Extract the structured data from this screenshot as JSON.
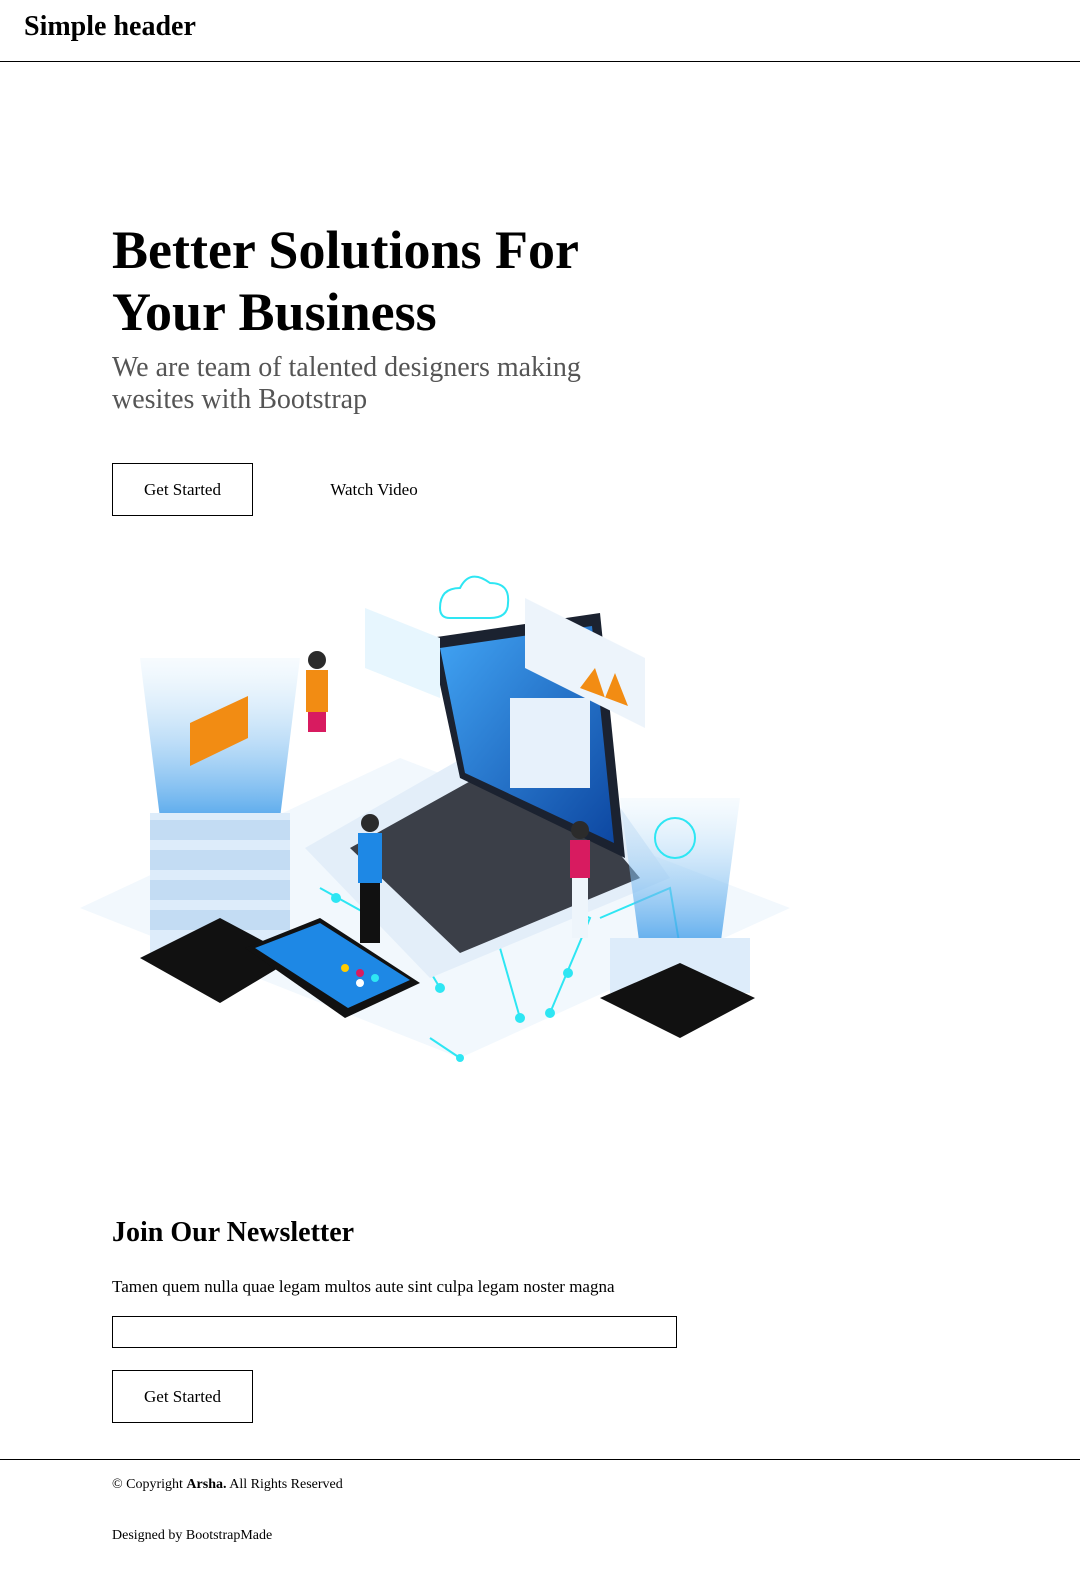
{
  "header": {
    "title": "Simple header"
  },
  "hero": {
    "title": "Better Solutions For Your Business",
    "subtitle": "We are team of talented designers making wesites with Bootstrap",
    "primary_button": "Get Started",
    "secondary_button": "Watch Video",
    "colors": {
      "accent_blue": "#1e88e5",
      "cyan": "#20d8f0",
      "orange": "#f28c13",
      "pink": "#d81b60"
    }
  },
  "newsletter": {
    "title": "Join Our Newsletter",
    "text": "Tamen quem nulla quae legam multos aute sint culpa legam noster magna",
    "input_value": "",
    "button": "Get Started"
  },
  "footer": {
    "copyright_prefix": "© Copyright ",
    "brand": "Arsha.",
    "copyright_suffix": " All Rights Reserved",
    "credits": "Designed by BootstrapMade"
  }
}
